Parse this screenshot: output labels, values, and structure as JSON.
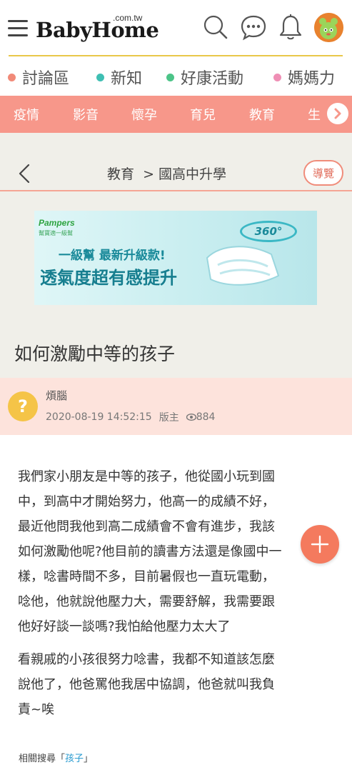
{
  "header": {
    "logo_main": "BabyHome",
    "logo_sub": ".com.tw",
    "icons": [
      "menu-icon",
      "search-icon",
      "chat-icon",
      "bell-icon"
    ]
  },
  "categories": [
    {
      "label": "討論區",
      "color": "#f18a78"
    },
    {
      "label": "新知",
      "color": "#3fbfb3"
    },
    {
      "label": "好康活動",
      "color": "#4cc488"
    },
    {
      "label": "媽媽力",
      "color": "#ef8fb5"
    }
  ],
  "subnav": [
    "疫情",
    "影音",
    "懷孕",
    "育兒",
    "教育",
    "生"
  ],
  "breadcrumb": {
    "text": "教育  > 國高中升學",
    "guide_button": "導覽"
  },
  "banner": {
    "brand": "Pampers",
    "brand_sub": "幫寶適一級幫",
    "line1": "一級幫 最新升級款!",
    "line2": "透氣度超有感提升",
    "badge": "360°"
  },
  "post": {
    "title": "如何激勵中等的孩子",
    "author": "煩腦",
    "avatar_glyph": "?",
    "datetime": "2020-08-19 14:52:15",
    "role": "版主",
    "views": "884",
    "paragraphs": [
      [
        "我們家小朋友是中等的孩子，他從國小玩到國",
        "中，到高中才開始努力，他高一的成績不好，",
        "最近他問我他到高二成績會不會有進步，我該",
        "如何激勵他呢?他目前的讀書方法還是像國中一",
        "樣，唸書時間不多，目前暑假也一直玩電動，",
        "唸他，他就說他壓力大，需要舒解，我需要跟",
        "他好好談一談嗎?我怕給他壓力太大了"
      ],
      [
        "看親戚的小孩很努力唸書，我都不知道該怎麼",
        "說他了，他爸罵他我居中協調，他爸就叫我負",
        "責~唉"
      ]
    ]
  },
  "related": {
    "label": "相關搜尋「",
    "keyword": "孩子",
    "close": "」"
  },
  "colors": {
    "accent": "#f7978a",
    "gold": "#e9c84a",
    "fab": "#f47a5e"
  }
}
